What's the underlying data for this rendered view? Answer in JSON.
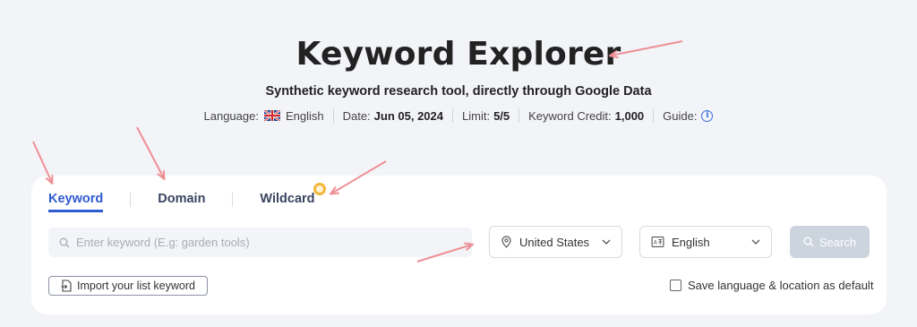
{
  "header": {
    "title": "Keyword Explorer",
    "subtitle": "Synthetic keyword research tool, directly through Google Data"
  },
  "meta": {
    "language_label": "Language:",
    "language_value": "English",
    "language_flag": "uk-flag-icon",
    "date_label": "Date:",
    "date_value": "Jun 05, 2024",
    "limit_label": "Limit:",
    "limit_value": "5/5",
    "credit_label": "Keyword Credit:",
    "credit_value": "1,000",
    "guide_label": "Guide:",
    "guide_icon": "info-icon"
  },
  "tabs": [
    {
      "label": "Keyword",
      "active": true
    },
    {
      "label": "Domain",
      "active": false
    },
    {
      "label": "Wildcard",
      "active": false,
      "badge": true
    }
  ],
  "search": {
    "placeholder": "Enter keyword (E.g: garden tools)",
    "value": "",
    "button_label": "Search"
  },
  "location_select": {
    "value": "United States",
    "icon": "location-pin-icon"
  },
  "language_select": {
    "value": "English",
    "icon": "translate-icon"
  },
  "import_button": {
    "label": "Import your list keyword",
    "icon": "import-file-icon"
  },
  "save_default": {
    "label": "Save language & location as default",
    "checked": false
  },
  "colors": {
    "background": "#f3f4f8",
    "accent": "#2f5bd3",
    "annotation_arrow": "#ee8f96",
    "badge": "#f4b63a",
    "search_button_disabled": "#ccd4de"
  }
}
